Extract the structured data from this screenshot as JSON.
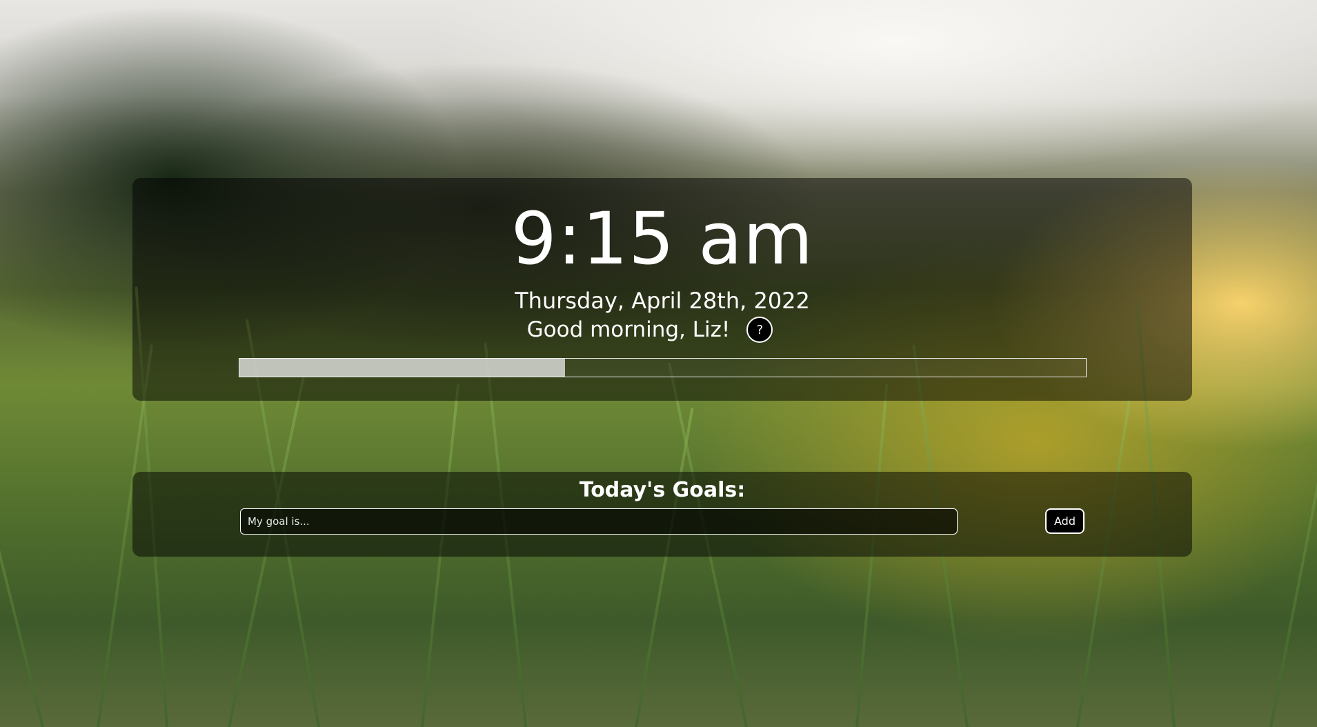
{
  "clock": {
    "time": "9:15 am",
    "date": "Thursday, April 28th, 2022",
    "greeting": "Good morning, Liz!",
    "help_label": "?",
    "day_progress": 0.385
  },
  "goals": {
    "title": "Today's Goals:",
    "input_placeholder": "My goal is...",
    "add_label": "Add"
  },
  "colors": {
    "text": "#ffffff",
    "card_overlay": "rgba(0,0,0,0.5)",
    "progress_fill": "#e6e6e6"
  }
}
